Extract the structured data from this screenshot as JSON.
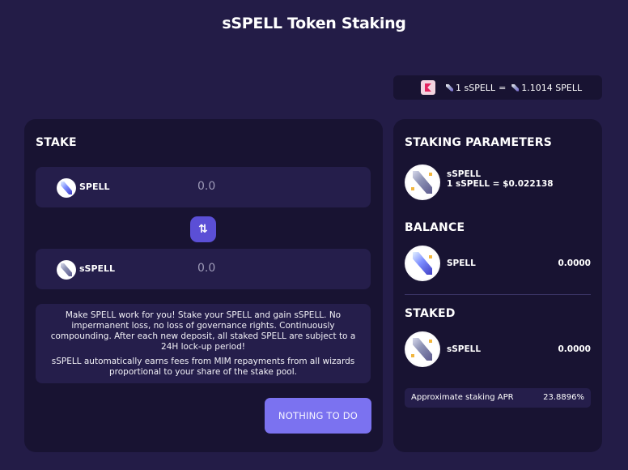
{
  "page": {
    "title": "sSPELL Token Staking"
  },
  "rate": {
    "lhs": "1 sSPELL",
    "eq": "=",
    "rhs": "1.1014 SPELL"
  },
  "stake": {
    "title": "STAKE",
    "from": {
      "token": "SPELL",
      "amount": "0.0"
    },
    "to": {
      "token": "sSPELL",
      "amount": "0.0"
    },
    "swap_icon": "swap-arrows-icon",
    "info": [
      "Make SPELL work for you! Stake your SPELL and gain sSPELL. No impermanent loss, no loss of governance rights. Continuously compounding. After each new deposit, all staked SPELL are subject to a 24H lock-up period!",
      "sSPELL automatically earns fees from MIM repayments from all wizards proportional to your share of the stake pool."
    ],
    "action_label": "NOTHING TO DO"
  },
  "params": {
    "title": "STAKING PARAMETERS",
    "token": "sSPELL",
    "price": "1 sSPELL = $0.022138",
    "balance_title": "BALANCE",
    "balance_token": "SPELL",
    "balance_value": "0.0000",
    "staked_title": "STAKED",
    "staked_token": "sSPELL",
    "staked_value": "0.0000",
    "apr_label": "Approximate staking APR",
    "apr_value": "23.8896%"
  },
  "colors": {
    "background": "#231c47",
    "card": "#181332",
    "panel": "#251e4b",
    "accent": "#7b72f0"
  }
}
